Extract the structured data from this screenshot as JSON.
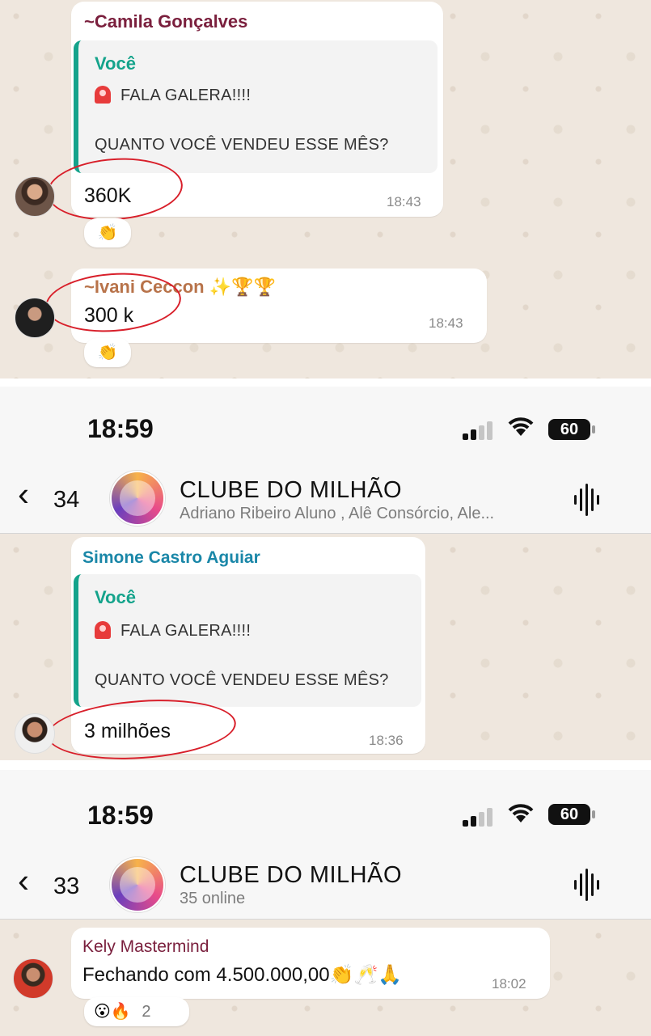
{
  "panel1": {
    "msg1": {
      "sender": "~Camila Gonçalves",
      "quote_author": "Você",
      "quote_line1": "FALA GALERA!!!!",
      "quote_line2": "QUANTO VOCÊ VENDEU ESSE MÊS?",
      "text": "360K",
      "time": "18:43",
      "reaction": "👏"
    },
    "msg2": {
      "sender": "~Ivani Ceccon ✨🏆🏆",
      "text": "300 k",
      "time": "18:43",
      "reaction": "👏"
    }
  },
  "panel2": {
    "status": {
      "time": "18:59",
      "battery": "60"
    },
    "header": {
      "back_count": "34",
      "title": "CLUBE DO MILHÃO",
      "subtitle": "Adriano Ribeiro Aluno , Alê Consórcio, Ale..."
    },
    "msg": {
      "sender": "Simone Castro Aguiar",
      "quote_author": "Você",
      "quote_line1": "FALA GALERA!!!!",
      "quote_line2": "QUANTO VOCÊ VENDEU ESSE MÊS?",
      "text": "3 milhões",
      "time": "18:36"
    }
  },
  "panel3": {
    "status": {
      "time": "18:59",
      "battery": "60"
    },
    "header": {
      "back_count": "33",
      "title": "CLUBE DO MILHÃO",
      "subtitle": "35 online"
    },
    "msg": {
      "sender": "Kely Mastermind",
      "text": "Fechando com 4.500.000,00👏🥂🙏",
      "time": "18:02",
      "reactions": "😮🔥",
      "reaction_count": "2"
    }
  },
  "icons": {
    "back": "‹",
    "wifi": "wifi-icon",
    "signal": "signal-icon",
    "audio": "audio-wave-icon",
    "siren": "siren-icon"
  },
  "colors": {
    "chat_bg": "#efe7de",
    "quote_accent": "#14a38b",
    "sender1": "#7a1f3d",
    "sender2": "#b8734a",
    "sender3": "#1a87a8",
    "sender4": "#7a1f3d",
    "annotation": "#d81f2a"
  }
}
